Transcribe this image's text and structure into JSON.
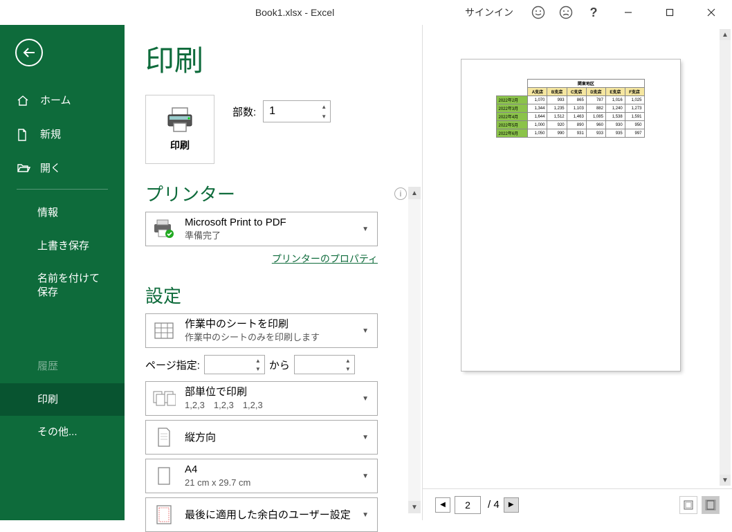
{
  "titlebar": {
    "title": "Book1.xlsx - Excel",
    "signin": "サインイン"
  },
  "sidebar": {
    "home": "ホーム",
    "new": "新規",
    "open": "開く",
    "info": "情報",
    "save": "上書き保存",
    "saveas": "名前を付けて保存",
    "history": "履歴",
    "print": "印刷",
    "other": "その他..."
  },
  "page": {
    "title": "印刷"
  },
  "printBtn": {
    "label": "印刷"
  },
  "copies": {
    "label": "部数:",
    "value": "1"
  },
  "printerSection": {
    "title": "プリンター"
  },
  "printer": {
    "name": "Microsoft Print to PDF",
    "status": "準備完了",
    "propsLink": "プリンターのプロパティ"
  },
  "settingsSection": {
    "title": "設定"
  },
  "printWhat": {
    "title": "作業中のシートを印刷",
    "sub": "作業中のシートのみを印刷します"
  },
  "pageRange": {
    "label": "ページ指定:",
    "to": "から"
  },
  "collate": {
    "title": "部単位で印刷",
    "sub": "1,2,3　1,2,3　1,2,3"
  },
  "orientation": {
    "title": "縦方向"
  },
  "paperSize": {
    "title": "A4",
    "sub": "21 cm x 29.7 cm"
  },
  "margins": {
    "title": "最後に適用した余白のユーザー設定"
  },
  "pagination": {
    "current": "2",
    "total": "/ 4"
  },
  "previewTable": {
    "topHeader": "関東地区",
    "cols": [
      "A支店",
      "B支店",
      "C支店",
      "D支店",
      "E支店",
      "F支店"
    ],
    "rows": [
      {
        "label": "2022年2月",
        "vals": [
          "1,070",
          "993",
          "865",
          "787",
          "1,016",
          "1,025"
        ]
      },
      {
        "label": "2022年3月",
        "vals": [
          "1,344",
          "1,235",
          "1,103",
          "882",
          "1,240",
          "1,273"
        ]
      },
      {
        "label": "2022年4月",
        "vals": [
          "1,644",
          "1,512",
          "1,463",
          "1,085",
          "1,538",
          "1,591"
        ]
      },
      {
        "label": "2022年5月",
        "vals": [
          "1,000",
          "920",
          "890",
          "960",
          "930",
          "950"
        ]
      },
      {
        "label": "2022年6月",
        "vals": [
          "1,050",
          "990",
          "931",
          "933",
          "935",
          "997"
        ]
      }
    ]
  }
}
